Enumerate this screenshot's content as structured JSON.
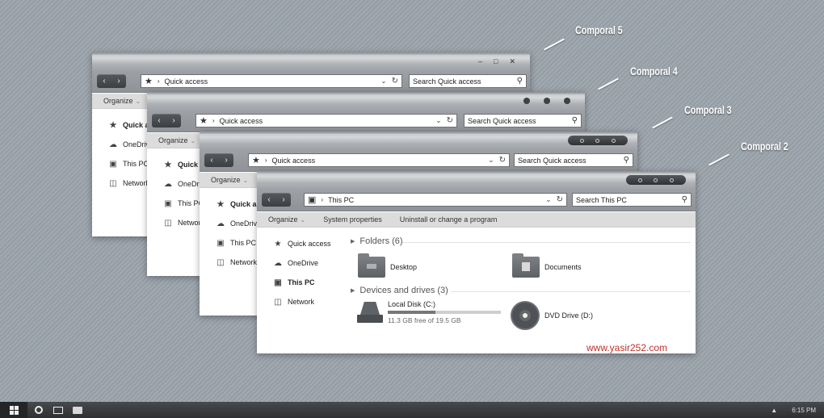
{
  "themes": [
    "Comporal 5",
    "Comporal 4",
    "Comporal 3",
    "Comporal 2"
  ],
  "windows": {
    "w5": {
      "address": "Quick access",
      "search": "Search Quick access",
      "organize": "Organize",
      "nav": [
        "Quick ac",
        "OneDrive",
        "This PC",
        "Network"
      ]
    },
    "w4": {
      "address": "Quick access",
      "search": "Search Quick access",
      "organize": "Organize",
      "nav": [
        "Quick a",
        "OneDriv",
        "This PC",
        "Network"
      ]
    },
    "w3": {
      "address": "Quick access",
      "search": "Search Quick access",
      "organize": "Organize",
      "nav": [
        "Quick a",
        "OneDrive",
        "This PC",
        "Network"
      ]
    },
    "w2": {
      "address": "This PC",
      "search": "Search This PC",
      "commands": [
        "Organize",
        "System properties",
        "Uninstall or change a program"
      ],
      "nav": [
        "Quick access",
        "OneDrive",
        "This PC",
        "Network"
      ],
      "folders_header": "Folders (6)",
      "folders": [
        "Desktop",
        "Documents"
      ],
      "devices_header": "Devices and drives (3)",
      "drives": {
        "local": {
          "name": "Local Disk (C:)",
          "free": "11.3 GB free of 19.5 GB",
          "used_fraction": 0.42
        },
        "dvd": {
          "name": "DVD Drive (D:)"
        }
      }
    }
  },
  "watermark": "www.yasir252.com",
  "taskbar": {
    "time": "6:15 PM"
  }
}
